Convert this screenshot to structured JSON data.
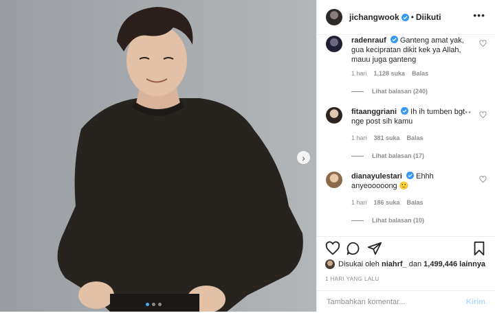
{
  "post": {
    "carousel": {
      "slide_count": 3,
      "active_index": 0,
      "next_icon": "chevron-right-icon"
    },
    "author": {
      "username": "jichangwook",
      "follow_status": "Diikuti",
      "separator": "•",
      "more_icon": "more-options-icon"
    }
  },
  "comments": [
    {
      "username": "radenrauf",
      "text": "Ganteng amat yak, gua kecipratan dikit kek ya Allah, mauu juga ganteng",
      "time": "1 hari",
      "likes": "1,128 suka",
      "reply_label": "Balas",
      "view_replies": "Lihat balasan (240)"
    },
    {
      "username": "fitaanggriani",
      "text": "Ih ih tumben bgt nge post sih kamu",
      "time": "1 hari",
      "likes": "381 suka",
      "reply_label": "Balas",
      "view_replies": "Lihat balasan (17)"
    },
    {
      "username": "dianayulestari",
      "text": "Ehhh anyeooooong",
      "emoji": "🙂",
      "time": "1 hari",
      "likes": "186 suka",
      "reply_label": "Balas",
      "view_replies": "Lihat balasan (10)"
    }
  ],
  "actions": {
    "liked_by_prefix": "Disukai oleh",
    "liked_by_user": "niahrf_",
    "liked_by_and": "dan",
    "liked_by_count": "1,499,446 lainnya",
    "timestamp": "1 HARI YANG LALU"
  },
  "comment_input": {
    "placeholder": "Tambahkan komentar...",
    "post_label": "Kirim"
  },
  "colors": {
    "accent": "#3897f0",
    "verified": "#3897f0",
    "muted": "#8e8e8e",
    "text": "#262626",
    "post_disabled": "#b3dbff"
  }
}
